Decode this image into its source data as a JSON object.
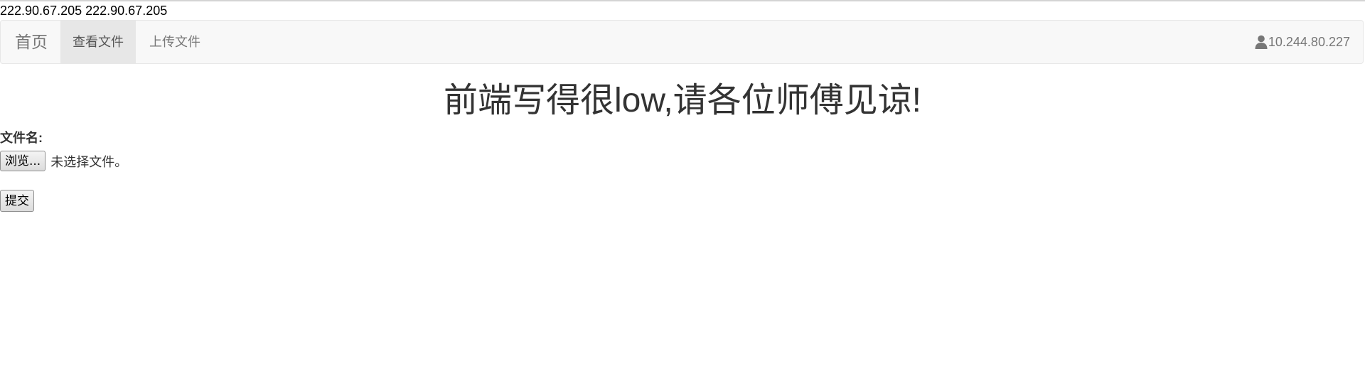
{
  "top_text": "222.90.67.205 222.90.67.205",
  "navbar": {
    "brand": "首页",
    "items": [
      {
        "label": "查看文件",
        "active": true
      },
      {
        "label": "上传文件",
        "active": false
      }
    ],
    "user_icon": "user-icon",
    "user_ip": "10.244.80.227"
  },
  "main": {
    "heading": "前端写得很low,请各位师傅见谅!",
    "file_label": "文件名:",
    "browse_button": "浏览...",
    "file_status": "未选择文件。",
    "submit_button": "提交"
  },
  "colors": {
    "navbar_bg": "#f8f8f8",
    "navbar_border": "#e7e7e7",
    "active_tab_bg": "#e7e7e7",
    "nav_text": "#777777",
    "heading_text": "#333333"
  }
}
